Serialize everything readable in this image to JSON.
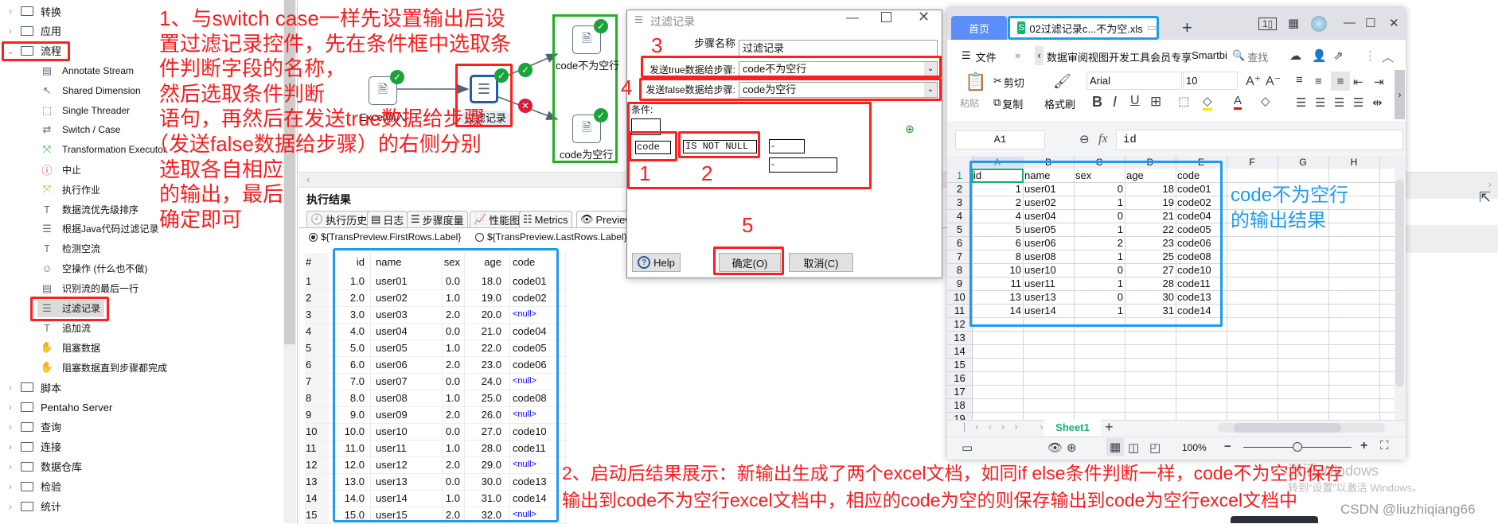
{
  "sidebar": {
    "items": [
      {
        "label": "转换",
        "kind": "folder",
        "expanded": false
      },
      {
        "label": "应用",
        "kind": "folder",
        "expanded": false
      },
      {
        "label": "流程",
        "kind": "folder",
        "expanded": true
      },
      {
        "label": "Annotate Stream",
        "kind": "step",
        "icon": "annotate-icon"
      },
      {
        "label": "Shared Dimension",
        "kind": "step",
        "icon": "shared-dimension-icon"
      },
      {
        "label": "Single Threader",
        "kind": "step",
        "icon": "single-threader-icon"
      },
      {
        "label": "Switch / Case",
        "kind": "step",
        "icon": "switch-icon"
      },
      {
        "label": "Transformation Executor",
        "kind": "step",
        "icon": "executor-icon"
      },
      {
        "label": "中止",
        "kind": "step",
        "icon": "abort-icon"
      },
      {
        "label": "执行作业",
        "kind": "step",
        "icon": "job-executor-icon"
      },
      {
        "label": "数据流优先级排序",
        "kind": "step",
        "icon": "priority-icon"
      },
      {
        "label": "根据Java代码过滤记录",
        "kind": "step",
        "icon": "java-filter-icon"
      },
      {
        "label": "检测空流",
        "kind": "step",
        "icon": "detect-empty-icon"
      },
      {
        "label": "空操作 (什么也不做)",
        "kind": "step",
        "icon": "dummy-icon"
      },
      {
        "label": "识别流的最后一行",
        "kind": "step",
        "icon": "last-row-icon"
      },
      {
        "label": "过滤记录",
        "kind": "step",
        "icon": "filter-rows-icon",
        "selected": true
      },
      {
        "label": "追加流",
        "kind": "step",
        "icon": "append-icon"
      },
      {
        "label": "阻塞数据",
        "kind": "step",
        "icon": "block-icon"
      },
      {
        "label": "阻塞数据直到步骤都完成",
        "kind": "step",
        "icon": "block-until-icon"
      },
      {
        "label": "脚本",
        "kind": "folder",
        "expanded": false
      },
      {
        "label": "Pentaho Server",
        "kind": "folder",
        "expanded": false
      },
      {
        "label": "查询",
        "kind": "folder",
        "expanded": false
      },
      {
        "label": "连接",
        "kind": "folder",
        "expanded": false
      },
      {
        "label": "数据仓库",
        "kind": "folder",
        "expanded": false
      },
      {
        "label": "检验",
        "kind": "folder",
        "expanded": false
      },
      {
        "label": "统计",
        "kind": "folder",
        "expanded": false
      }
    ]
  },
  "canvas": {
    "excel_input": "Excel输入",
    "filter": "过滤记录",
    "out_not_null": "code不为空行",
    "out_null": "code为空行"
  },
  "results": {
    "title": "执行结果",
    "tabs": [
      "执行历史",
      "日志",
      "步骤度量",
      "性能图",
      "Metrics",
      "Preview"
    ],
    "radio_first": "${TransPreview.FirstRows.Label}",
    "radio_last": "${TransPreview.LastRows.Label}",
    "columns": [
      "#",
      "id",
      "name",
      "sex",
      "age",
      "code"
    ],
    "null_color": "#0000ff",
    "rows": [
      [
        "1",
        "1.0",
        "user01",
        "0.0",
        "18.0",
        "code01"
      ],
      [
        "2",
        "2.0",
        "user02",
        "1.0",
        "19.0",
        "code02"
      ],
      [
        "3",
        "3.0",
        "user03",
        "2.0",
        "20.0",
        "<null>"
      ],
      [
        "4",
        "4.0",
        "user04",
        "0.0",
        "21.0",
        "code04"
      ],
      [
        "5",
        "5.0",
        "user05",
        "1.0",
        "22.0",
        "code05"
      ],
      [
        "6",
        "6.0",
        "user06",
        "2.0",
        "23.0",
        "code06"
      ],
      [
        "7",
        "7.0",
        "user07",
        "0.0",
        "24.0",
        "<null>"
      ],
      [
        "8",
        "8.0",
        "user08",
        "1.0",
        "25.0",
        "code08"
      ],
      [
        "9",
        "9.0",
        "user09",
        "2.0",
        "26.0",
        "<null>"
      ],
      [
        "10",
        "10.0",
        "user10",
        "0.0",
        "27.0",
        "code10"
      ],
      [
        "11",
        "11.0",
        "user11",
        "1.0",
        "28.0",
        "code11"
      ],
      [
        "12",
        "12.0",
        "user12",
        "2.0",
        "29.0",
        "<null>"
      ],
      [
        "13",
        "13.0",
        "user13",
        "0.0",
        "30.0",
        "code13"
      ],
      [
        "14",
        "14.0",
        "user14",
        "1.0",
        "31.0",
        "code14"
      ],
      [
        "15",
        "15.0",
        "user15",
        "2.0",
        "32.0",
        "<null>"
      ]
    ]
  },
  "dialog": {
    "title": "过滤记录",
    "step_name_label": "步骤名称",
    "step_name_value": "过滤记录",
    "true_label": "发送true数据给步骤:",
    "true_value": "code不为空行",
    "false_label": "发送false数据给步骤:",
    "false_value": "code为空行",
    "condition_label": "条件:",
    "field": "code",
    "operator": "IS NOT NULL",
    "value1": "-",
    "value2": "-",
    "help": "Help",
    "ok": "确定(O)",
    "cancel": "取消(C)"
  },
  "excel": {
    "home_tab": "首页",
    "file_tab": "02过滤记录c...不为空.xls",
    "file_menu": "文件",
    "ribbon_tabs": [
      "数据",
      "审阅",
      "视图",
      "开发工具",
      "会员专享",
      "Smartbi"
    ],
    "search": "查找",
    "paste": "粘贴",
    "cut": "剪切",
    "copy": "复制",
    "format_painter": "格式刷",
    "font": "Arial",
    "font_size": "10",
    "name_box": "A1",
    "fx": "fx",
    "formula": "id",
    "columns": [
      "A",
      "B",
      "C",
      "D",
      "E",
      "F",
      "G",
      "H"
    ],
    "row_numbers": [
      "1",
      "2",
      "3",
      "4",
      "5",
      "6",
      "7",
      "8",
      "9",
      "10",
      "11",
      "12",
      "13",
      "14",
      "15",
      "16",
      "17",
      "18",
      "19"
    ],
    "cells": [
      [
        "id",
        "name",
        "sex",
        "age",
        "code"
      ],
      [
        "1",
        "user01",
        "0",
        "18",
        "code01"
      ],
      [
        "2",
        "user02",
        "1",
        "19",
        "code02"
      ],
      [
        "4",
        "user04",
        "0",
        "21",
        "code04"
      ],
      [
        "5",
        "user05",
        "1",
        "22",
        "code05"
      ],
      [
        "6",
        "user06",
        "2",
        "23",
        "code06"
      ],
      [
        "8",
        "user08",
        "1",
        "25",
        "code08"
      ],
      [
        "10",
        "user10",
        "0",
        "27",
        "code10"
      ],
      [
        "11",
        "user11",
        "1",
        "28",
        "code11"
      ],
      [
        "13",
        "user13",
        "0",
        "30",
        "code13"
      ],
      [
        "14",
        "user14",
        "1",
        "31",
        "code14"
      ]
    ],
    "sheet_tab": "Sheet1",
    "zoom": "100%",
    "zoom_fraction": 0.5
  },
  "annotations": {
    "step1_lines": [
      "1、与switch case一样先设置输出后设",
      "置过滤记录控件，先在条件框中选取条",
      "件判断字段的名称，",
      "然后选取条件判断",
      "语句，再然后在发送true数据给步骤",
      "（发送false数据给步骤）的右侧分别",
      "选取各自相应",
      "的输出，最后",
      "确定即可"
    ],
    "n1": "1",
    "n2": "2",
    "n3": "3",
    "n4": "4",
    "n5": "5",
    "blue_lines": [
      "code不为空行",
      "的输出结果"
    ],
    "bottom_lines": [
      "2、启动后结果展示：新输出生成了两个excel文档，如同if else条件判断一样，code不为空的保存",
      "输出到code不为空行excel文档中，相应的code为空的则保存输出到code为空行excel文档中"
    ],
    "red": "#ff1a1a",
    "blue": "#1e9bf0"
  },
  "watermark": {
    "activate1": "激活 Windows",
    "activate2": "转到“设置”以激活 Windows。",
    "csdn": "CSDN @liuzhiqiang66"
  }
}
